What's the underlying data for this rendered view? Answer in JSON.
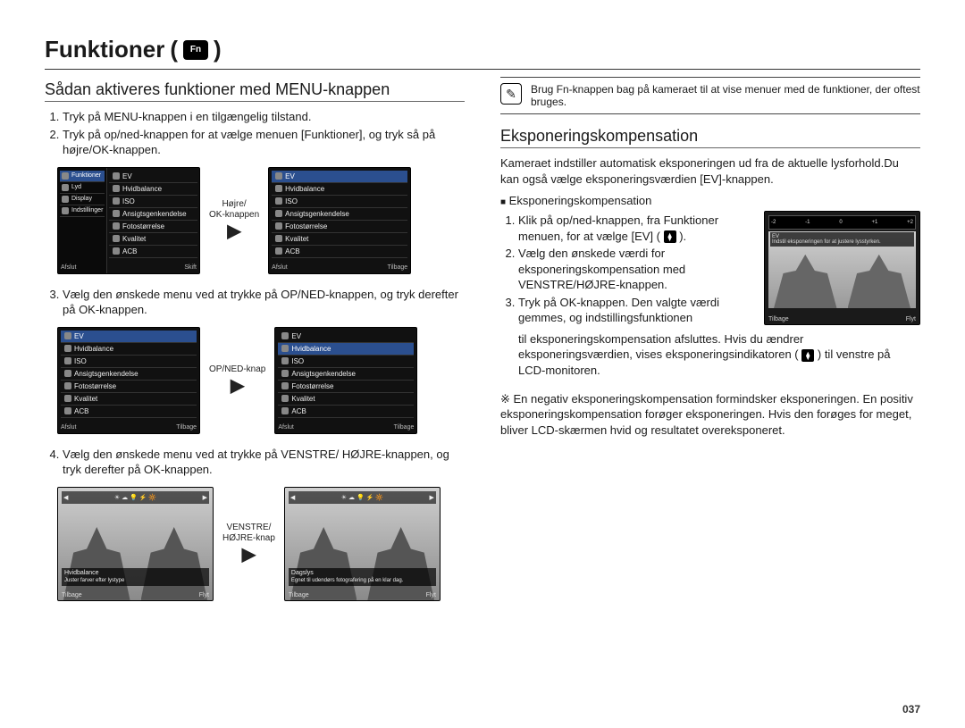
{
  "title": "Funktioner",
  "title_icon": "Fn",
  "pagenum": "037",
  "left": {
    "heading": "Sådan aktiveres funktioner med MENU-knappen",
    "step1": "Tryk på MENU-knappen i en tilgængelig tilstand.",
    "step2": "Tryk på op/ned-knappen for at vælge menuen [Funktioner], og tryk så på højre/OK-knappen.",
    "arrow1_line1": "Højre/",
    "arrow1_line2": "OK-knappen",
    "step3": "Vælg den ønskede menu ved at trykke på OP/NED-knappen, og tryk derefter på OK-knappen.",
    "arrow2": "OP/NED-knap",
    "step4": "Vælg den ønskede menu ved at trykke på VENSTRE/ HØJRE-knappen, og tryk derefter på OK-knappen.",
    "arrow3_line1": "VENSTRE/",
    "arrow3_line2": "HØJRE-knap",
    "menu_side": {
      "funktioner": "Funktioner",
      "lyd": "Lyd",
      "display": "Display",
      "indstillinger": "Indstillinger"
    },
    "menu_main": {
      "ev": "EV",
      "hvidbalance": "Hvidbalance",
      "iso": "ISO",
      "ansigt": "Ansigtsgenkendelse",
      "foto": "Fotostørrelse",
      "kvalitet": "Kvalitet",
      "acb": "ACB"
    },
    "footer": {
      "afslut": "Afslut",
      "skift": "Skift",
      "tilbage": "Tilbage"
    },
    "wb": {
      "title_left": "Hvidbalance",
      "desc_left": "Juster farver efter lystype",
      "title_right": "Dagslys",
      "desc_right": "Egnet til udendørs fotografering på en klar dag.",
      "tilbage": "Tilbage",
      "flyt": "Flyt"
    }
  },
  "right": {
    "note": "Brug Fn-knappen bag på kameraet til at vise menuer med de funktioner, der oftest bruges.",
    "heading": "Eksponeringskompensation",
    "para": "Kameraet indstiller automatisk eksponeringen ud fra de aktuelle lysforhold.Du kan også vælge eksponeringsværdien [EV]-knappen.",
    "sub_bullet": "Eksponeringskompensation",
    "step1": "Klik på op/ned-knappen, fra Funktioner menuen, for at vælge [EV] (",
    "step1_tail": ").",
    "step2": "Vælg den ønskede værdi for eksponeringskompensation med VENSTRE/HØJRE-knappen.",
    "step3": "Tryk på OK-knappen. Den valgte værdi gemmes, og indstillingsfunktionen",
    "step3_cont": "til eksponeringskompensation afsluttes. Hvis du ændrer eksponeringsværdien, vises eksponeringsindikatoren (",
    "step3_tail": ") til venstre på LCD-monitoren.",
    "footnote": "※ En negativ eksponeringskompensation formindsker eksponeringen. En positiv eksponeringskompensation forøger eksponeringen. Hvis den forøges for meget, bliver LCD-skærmen hvid og resultatet overeksponeret.",
    "ev_scale": [
      "-2",
      "-1",
      "0",
      "+1",
      "+2"
    ],
    "ev_label": "EV",
    "ev_hint": "Indstil eksponeringen for at justere lysstyrken.",
    "ev_tilbage": "Tilbage",
    "ev_flyt": "Flyt"
  }
}
